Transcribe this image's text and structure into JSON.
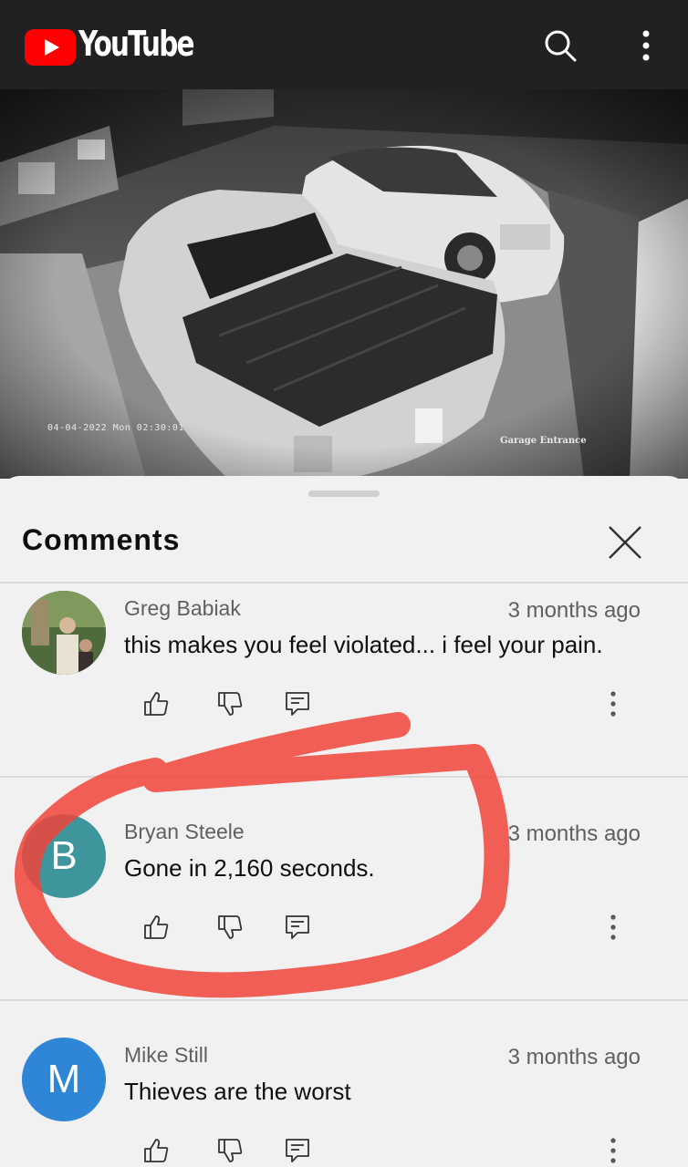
{
  "app": {
    "logo_text": "YouTube"
  },
  "video": {
    "timestamp_overlay": "04-04-2022 Mon 02:30:01",
    "camera_label": "Garage Entrance"
  },
  "comments_panel": {
    "title": "Comments",
    "comments": [
      {
        "author": "Greg Babiak",
        "time": "3 months ago",
        "text": "this makes you feel violated... i feel your pain.",
        "avatar_letter": "",
        "avatar_color": "#5b7a4a"
      },
      {
        "author": "Bryan Steele",
        "time": "3 months ago",
        "text": "Gone in 2,160 seconds.",
        "avatar_letter": "B",
        "avatar_color": "#3e959c"
      },
      {
        "author": "Mike Still",
        "time": "3 months ago",
        "text": "Thieves are the worst",
        "avatar_letter": "M",
        "avatar_color": "#2f85d6"
      }
    ]
  },
  "colors": {
    "app_bar": "#212121",
    "youtube_red": "#ff0000",
    "annotation_red": "#f0443a"
  }
}
